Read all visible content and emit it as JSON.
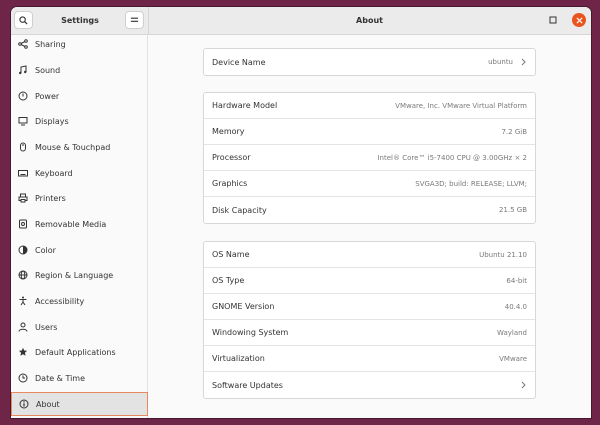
{
  "window": {
    "sidebar_title": "Settings",
    "title": "About"
  },
  "sidebar": {
    "items": [
      {
        "label": "Sharing",
        "icon": "share-icon"
      },
      {
        "label": "Sound",
        "icon": "music-note-icon"
      },
      {
        "label": "Power",
        "icon": "power-icon"
      },
      {
        "label": "Displays",
        "icon": "display-icon"
      },
      {
        "label": "Mouse & Touchpad",
        "icon": "mouse-icon"
      },
      {
        "label": "Keyboard",
        "icon": "keyboard-icon"
      },
      {
        "label": "Printers",
        "icon": "printer-icon"
      },
      {
        "label": "Removable Media",
        "icon": "media-icon"
      },
      {
        "label": "Color",
        "icon": "color-icon"
      },
      {
        "label": "Region & Language",
        "icon": "globe-icon"
      },
      {
        "label": "Accessibility",
        "icon": "accessibility-icon"
      },
      {
        "label": "Users",
        "icon": "users-icon"
      },
      {
        "label": "Default Applications",
        "icon": "star-icon"
      },
      {
        "label": "Date & Time",
        "icon": "clock-icon"
      },
      {
        "label": "About",
        "icon": "info-icon"
      }
    ],
    "active": "About"
  },
  "device": {
    "name_label": "Device Name",
    "name_value": "ubuntu"
  },
  "hardware": {
    "model_label": "Hardware Model",
    "model_value": "VMware, Inc. VMware Virtual Platform",
    "memory_label": "Memory",
    "memory_value": "7.2 GiB",
    "processor_label": "Processor",
    "processor_value": "Intel® Core™ i5-7400 CPU @ 3.00GHz × 2",
    "graphics_label": "Graphics",
    "graphics_value": "SVGA3D; build: RELEASE; LLVM;",
    "disk_label": "Disk Capacity",
    "disk_value": "21.5 GB"
  },
  "software": {
    "os_name_label": "OS Name",
    "os_name_value": "Ubuntu 21.10",
    "os_type_label": "OS Type",
    "os_type_value": "64-bit",
    "gnome_label": "GNOME Version",
    "gnome_value": "40.4.0",
    "windowing_label": "Windowing System",
    "windowing_value": "Wayland",
    "virtualization_label": "Virtualization",
    "virtualization_value": "VMware",
    "updates_label": "Software Updates"
  },
  "colors": {
    "accent": "#e95420",
    "desktop": "#6e2548",
    "active_border": "#e9875f"
  }
}
